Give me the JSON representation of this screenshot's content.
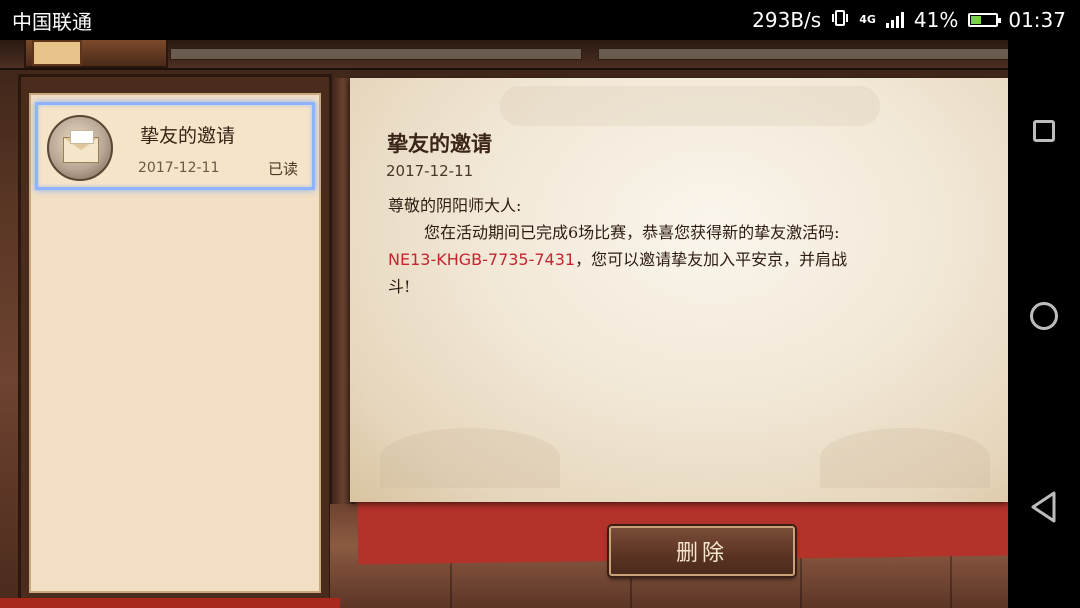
{
  "status_bar": {
    "carrier": "中国联通",
    "net_speed": "293B/s",
    "network_type": "4G",
    "battery_percent": "41%",
    "battery_level": 0.41,
    "time": "01:37"
  },
  "mail_list": {
    "items": [
      {
        "title": "挚友的邀请",
        "date": "2017-12-11",
        "status": "已读",
        "icon": "envelope-icon",
        "selected": true
      }
    ]
  },
  "letter": {
    "title": "挚友的邀请",
    "date": "2017-12-11",
    "greeting": "尊敬的阴阳师大人:",
    "line1": "您在活动期间已完成6场比赛，恭喜您获得新的挚友激活码:",
    "code": "NE13-KHGB-7735-7431",
    "line2_rest": "，您可以邀请挚友加入平安京，并肩战",
    "line3": "斗!"
  },
  "actions": {
    "delete_label": "删除"
  },
  "nav": {
    "recents_icon": "square-icon",
    "home_icon": "circle-icon",
    "back_icon": "triangle-back-icon"
  },
  "colors": {
    "code_red": "#c3262f",
    "selection_blue": "#8fb4ff"
  }
}
